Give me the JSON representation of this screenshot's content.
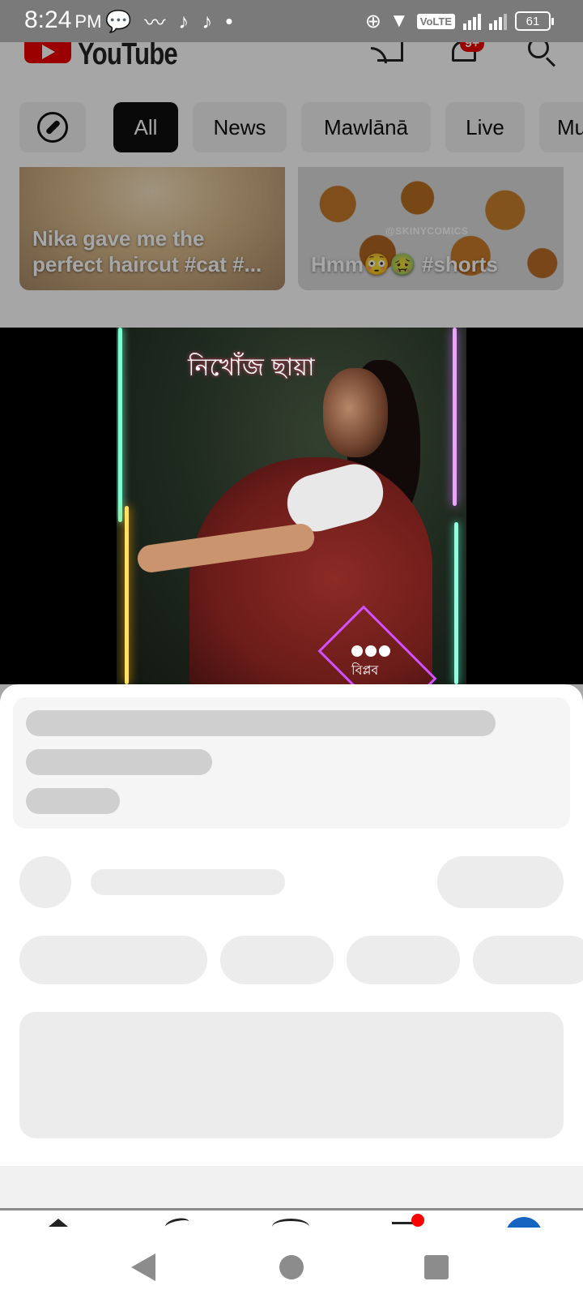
{
  "status_bar": {
    "time": "8:24",
    "ampm": "PM",
    "volte": "VoLTE",
    "battery": "61"
  },
  "header": {
    "logo_text": "YouTube",
    "notification_badge": "9+"
  },
  "chips": [
    {
      "label": "All",
      "active": true
    },
    {
      "label": "News"
    },
    {
      "label": "Mawlānā"
    },
    {
      "label": "Live"
    },
    {
      "label": "Mu"
    }
  ],
  "shorts": [
    {
      "title": "Nika gave me the perfect haircut #cat #..."
    },
    {
      "title": "Hmm😳🤢 #shorts",
      "watermark": "@SKINYCOMICS"
    }
  ],
  "player": {
    "overlay_text": "নিখোঁজ ছায়া",
    "channel_text": "বিপ্লব"
  },
  "colors": {
    "brand_red": "#ff0000",
    "chip_active_bg": "#0f0f0f",
    "skeleton": "#ececec"
  }
}
